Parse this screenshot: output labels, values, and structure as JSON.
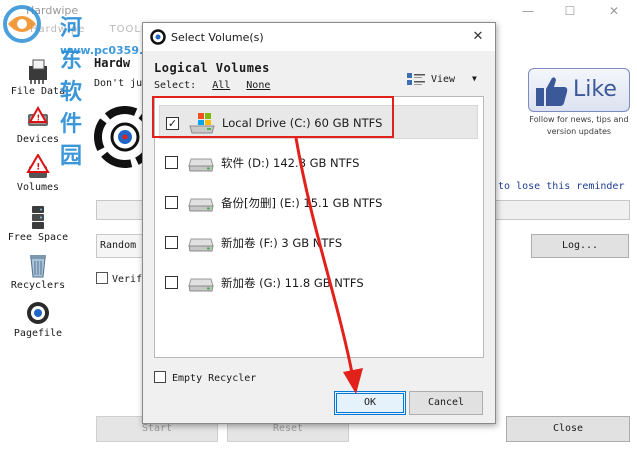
{
  "app": {
    "title": "Hardwipe",
    "menu": [
      "Hardwipe",
      "TOOLS"
    ],
    "heading": "Hardw",
    "description": "Don't ju",
    "reminder": "w to lose this reminder",
    "wipe_method": "Random D",
    "log_label": "Log...",
    "verify_label": "Verif",
    "start_label": "Start",
    "reset_label": "Reset",
    "close_label": "Close"
  },
  "watermark": {
    "text": "河东软件园",
    "url": "www.pc0359.cn"
  },
  "sidebar": {
    "items": [
      {
        "label": "File Data",
        "icon": "file-shredder-icon"
      },
      {
        "label": "Devices",
        "icon": "device-warning-icon"
      },
      {
        "label": "Volumes",
        "icon": "volume-warning-icon"
      },
      {
        "label": "Free Space",
        "icon": "free-space-icon"
      },
      {
        "label": "Recyclers",
        "icon": "recycle-bin-icon"
      },
      {
        "label": "Pagefile",
        "icon": "pagefile-icon"
      }
    ]
  },
  "like_panel": {
    "button_label": "Like",
    "caption": "Follow for news, tips and version updates"
  },
  "dialog": {
    "title": "Select Volume(s)",
    "close_glyph": "✕",
    "section_heading": "Logical Volumes",
    "select_label": "Select:",
    "select_all": "All",
    "select_none": "None",
    "view_label": "View",
    "volumes": [
      {
        "label": "Local Drive (C:) 60 GB NTFS",
        "checked": true,
        "icon": "system-drive-icon"
      },
      {
        "label": "软件 (D:) 142.8 GB NTFS",
        "checked": false,
        "icon": "hard-drive-icon"
      },
      {
        "label": "备份[勿删] (E:) 15.1 GB NTFS",
        "checked": false,
        "icon": "hard-drive-icon"
      },
      {
        "label": "新加卷 (F:) 3 GB NTFS",
        "checked": false,
        "icon": "hard-drive-icon"
      },
      {
        "label": "新加卷 (G:) 11.8 GB NTFS",
        "checked": false,
        "icon": "hard-drive-icon"
      }
    ],
    "empty_recycler_label": "Empty Recycler",
    "ok_label": "OK",
    "cancel_label": "Cancel",
    "check_glyph": "✓"
  },
  "colors": {
    "accent": "#0078d7",
    "annotation": "#e3211b",
    "watermark": "#2b8fd6",
    "like": "#3b5998"
  }
}
